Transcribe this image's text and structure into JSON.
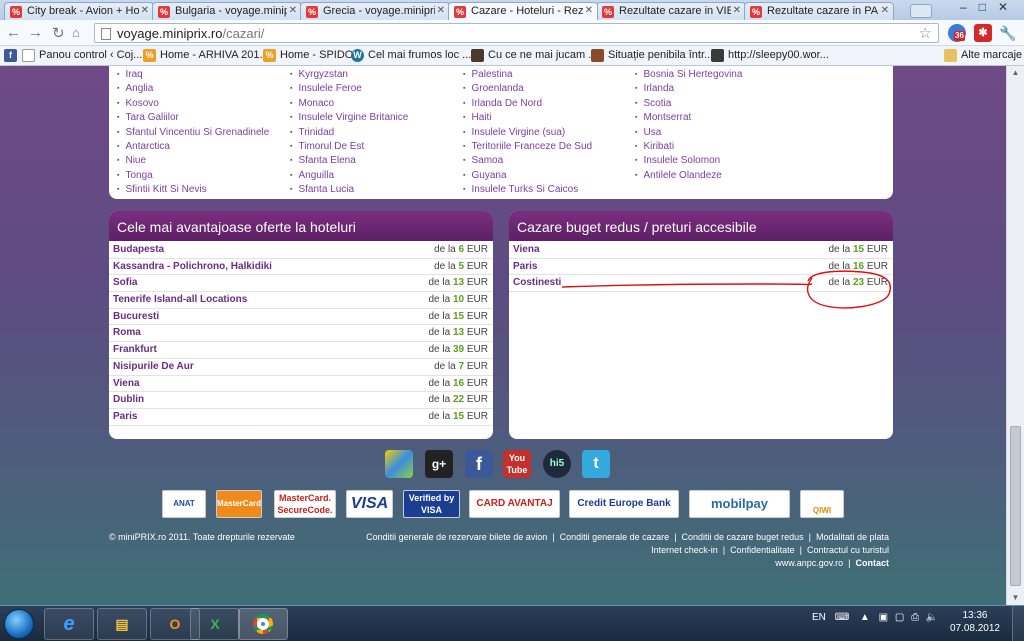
{
  "browser": {
    "tabs": [
      {
        "label": "City break - Avion + Hote",
        "active": false
      },
      {
        "label": "Bulgaria - voyage.miniprix.r",
        "active": false
      },
      {
        "label": "Grecia - voyage.miniprix.r",
        "active": false
      },
      {
        "label": "Cazare - Hoteluri - Rezerv",
        "active": true
      },
      {
        "label": "Rezultate cazare in VIENA",
        "active": false
      },
      {
        "label": "Rezultate cazare in PARIS",
        "active": false
      }
    ],
    "tab_favicon": "%",
    "url_host": "voyage.miniprix.ro",
    "url_path": "/cazari/",
    "ext_badge": "36",
    "bookmarks": [
      {
        "label": "Panou control ‹ Coj..."
      },
      {
        "label": "Home - ARHIVA 201..."
      },
      {
        "label": "Home - SPIDO"
      },
      {
        "label": "Cel mai frumos loc ..."
      },
      {
        "label": "Cu ce ne mai jucam ..."
      },
      {
        "label": "Situație penibila într..."
      },
      {
        "label": "http://sleepy00.wor..."
      }
    ],
    "other_bookmarks": "Alte marcaje"
  },
  "countries": {
    "col1": [
      "Iraq",
      "Anglia",
      "Kosovo",
      "Tara Galiilor",
      "Sfantul Vincentiu Si Grenadinele",
      "Antarctica",
      "Niue",
      "Tonga",
      "Sfintii Kitt Si Nevis"
    ],
    "col2": [
      "Kyrgyzstan",
      "Insulele Feroe",
      "Monaco",
      "Insulele Virgine Britanice",
      "Trinidad",
      "Timorul De Est",
      "Sfanta Elena",
      "Anguilla",
      "Sfanta Lucia"
    ],
    "col3": [
      "Palestina",
      "Groenlanda",
      "Irlanda De Nord",
      "Haiti",
      "Insulele Virgine (sua)",
      "Teritoriile Franceze De Sud",
      "Samoa",
      "Guyana",
      "Insulele Turks Si Caicos"
    ],
    "col4": [
      "Bosnia Si Hertegovina",
      "Irlanda",
      "Scotia",
      "Montserrat",
      "Usa",
      "Kiribati",
      "Insulele Solomon",
      "Antilele Olandeze"
    ]
  },
  "best_offers": {
    "title": "Cele mai avantajoase oferte la hoteluri",
    "price_prefix": "de la",
    "currency": "EUR",
    "rows": [
      {
        "city": "Budapesta",
        "price": "6"
      },
      {
        "city": "Kassandra - Polichrono, Halkidiki",
        "price": "5"
      },
      {
        "city": "Sofia",
        "price": "13"
      },
      {
        "city": "Tenerife Island-all Locations",
        "price": "10"
      },
      {
        "city": "Bucuresti",
        "price": "15"
      },
      {
        "city": "Roma",
        "price": "13"
      },
      {
        "city": "Frankfurt",
        "price": "39"
      },
      {
        "city": "Nisipurile De Aur",
        "price": "7"
      },
      {
        "city": "Viena",
        "price": "16"
      },
      {
        "city": "Dublin",
        "price": "22"
      },
      {
        "city": "Paris",
        "price": "15"
      }
    ]
  },
  "budget": {
    "title": "Cazare buget redus / preturi accesibile",
    "price_prefix": "de la",
    "currency": "EUR",
    "rows": [
      {
        "city": "Viena",
        "price": "15"
      },
      {
        "city": "Paris",
        "price": "16"
      },
      {
        "city": "Costinesti",
        "price": "23"
      }
    ]
  },
  "social": [
    {
      "name": "delicious",
      "label": ""
    },
    {
      "name": "google-plus",
      "label": "g+"
    },
    {
      "name": "facebook",
      "label": "f"
    },
    {
      "name": "youtube",
      "label": "You Tube"
    },
    {
      "name": "hi5",
      "label": "hi5"
    },
    {
      "name": "twitter",
      "label": "t"
    }
  ],
  "payments": [
    {
      "name": "anat",
      "label": "ANAT"
    },
    {
      "name": "mastercard",
      "label": "MasterCard"
    },
    {
      "name": "mastercard-securecode",
      "label": "MasterCard. SecureCode."
    },
    {
      "name": "visa",
      "label": "VISA"
    },
    {
      "name": "verified-by-visa",
      "label": "Verified by VISA"
    },
    {
      "name": "card-avantaj",
      "label": "CARD AVANTAJ"
    },
    {
      "name": "credit-europe-bank",
      "label": "Credit Europe Bank"
    },
    {
      "name": "mobilpay",
      "label": "mobilpay"
    },
    {
      "name": "qiwi",
      "label": "QIWI"
    }
  ],
  "footer": {
    "copyright": "© miniPRIX.ro 2011. Toate drepturile rezervate",
    "links_row1": [
      "Conditii generale de rezervare bilete de avion",
      "Conditii generale de cazare",
      "Conditii de cazare buget redus",
      "Modalitati de plata"
    ],
    "links_row2": [
      "Internet check-in",
      "Confidentialitate",
      "Contractul cu turistul"
    ],
    "links_row3": [
      "www.anpc.gov.ro",
      "Contact"
    ]
  },
  "taskbar": {
    "language": "EN",
    "time": "13:36",
    "date": "07.08.2012"
  },
  "colors": {
    "accent_purple": "#6b2c84",
    "price_green": "#5aa022",
    "annotation_red": "#e01010"
  }
}
